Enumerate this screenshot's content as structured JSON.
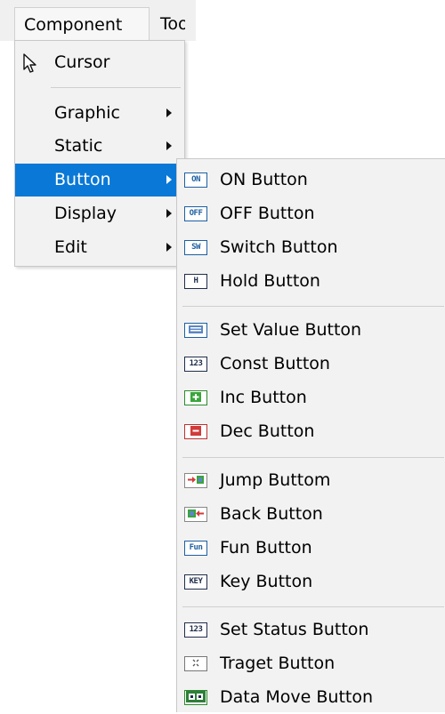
{
  "menubar": {
    "component_label": "Component",
    "tools_label": "Tools"
  },
  "primary_menu": {
    "cursor_label": "Cursor",
    "items": [
      {
        "label": "Graphic"
      },
      {
        "label": "Static"
      },
      {
        "label": "Button"
      },
      {
        "label": "Display"
      },
      {
        "label": "Edit"
      }
    ]
  },
  "button_submenu": {
    "group1": [
      {
        "label": "ON Button",
        "icon": "on-button-icon",
        "icon_text": "ON"
      },
      {
        "label": "OFF Button",
        "icon": "off-button-icon",
        "icon_text": "OFF"
      },
      {
        "label": "Switch Button",
        "icon": "switch-button-icon",
        "icon_text": "SW"
      },
      {
        "label": "Hold Button",
        "icon": "hold-button-icon",
        "icon_text": "H"
      }
    ],
    "group2": [
      {
        "label": "Set Value Button",
        "icon": "set-value-icon",
        "icon_text": ""
      },
      {
        "label": "Const Button",
        "icon": "const-icon",
        "icon_text": "123"
      },
      {
        "label": "Inc Button",
        "icon": "inc-icon",
        "icon_text": "+"
      },
      {
        "label": "Dec Button",
        "icon": "dec-icon",
        "icon_text": "−"
      }
    ],
    "group3": [
      {
        "label": "Jump Buttom",
        "icon": "jump-icon",
        "icon_text": ""
      },
      {
        "label": "Back Button",
        "icon": "back-icon",
        "icon_text": ""
      },
      {
        "label": "Fun Button",
        "icon": "fun-icon",
        "icon_text": "Fun"
      },
      {
        "label": "Key Button",
        "icon": "key-icon",
        "icon_text": "KEY"
      }
    ],
    "group4": [
      {
        "label": "Set Status Button",
        "icon": "set-status-icon",
        "icon_text": "123"
      },
      {
        "label": "Traget Button",
        "icon": "target-icon",
        "icon_text": ""
      },
      {
        "label": "Data Move Button",
        "icon": "data-move-icon",
        "icon_text": ""
      }
    ]
  },
  "colors": {
    "highlight": "#0a78d6",
    "menu_bg": "#f2f2f2",
    "icon_blue": "#1d5fa0"
  }
}
